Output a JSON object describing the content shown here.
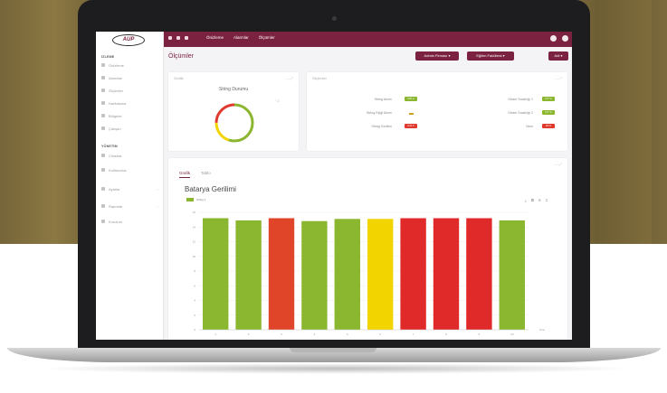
{
  "topbar": {
    "menu": [
      "Önizleme",
      "Alarmlar",
      "Ölçümler"
    ]
  },
  "sidebar": {
    "section1": "İZLEME",
    "items1": [
      "Önizleme",
      "Alarmlar",
      "Ölçümler",
      "Haritalama",
      "Bölgeler",
      "Çalışan"
    ],
    "section2": "YÖNETİM",
    "items2": [
      {
        "label": "Cihazlar",
        "chevron": false
      },
      {
        "label": "Kullanıcılar",
        "chevron": false
      },
      {
        "label": "Ayarlar",
        "chevron": true
      },
      {
        "label": "Raporlar",
        "chevron": true
      },
      {
        "label": "Kurulum",
        "chevron": false
      }
    ]
  },
  "header": {
    "title": "Ölçümler",
    "dropdown1": "Admin Firması ▾",
    "dropdown2": "Eğitim Fakültesi ▾",
    "dropdown3": "Adi ▾"
  },
  "grafik_card": {
    "title": "Grafik",
    "ctrl": "— ⤢",
    "donut_title": "String Durumu",
    "donut": {
      "green": 0.55,
      "yellow": 0.2,
      "red": 0.25
    }
  },
  "olcumler_card": {
    "title": "Ölçümler",
    "ctrl": "— ⤢",
    "rows_left": [
      {
        "label": "String Akımı",
        "value": "0.81 A",
        "color": "#8bb630"
      },
      {
        "label": "String Eşiği Akımı",
        "value": "—",
        "color": "#c9a320"
      },
      {
        "label": "String Gerilimi",
        "value": "0.01 V",
        "color": "#e03a2f"
      }
    ],
    "rows_right": [
      {
        "label": "Ortam Sıcaklığı 1",
        "value": "0.0 °C",
        "color": "#8bb630"
      },
      {
        "label": "Ortam Sıcaklığı 2",
        "value": "0.0 °C",
        "color": "#8bb630"
      },
      {
        "label": "Nem",
        "value": "20 %",
        "color": "#e03a2f"
      }
    ]
  },
  "chart_card": {
    "tab_active": "Grafik",
    "tab_other": "Tablo",
    "ctrl": "— ⤢",
    "tools": "⤓ ▦ ⊞ ⊡"
  },
  "chart_data": {
    "type": "bar",
    "title": "Batarya Gerilimi",
    "legend": [
      "String 1"
    ],
    "categories": [
      "1",
      "2",
      "3",
      "4",
      "5",
      "6",
      "7",
      "8",
      "9",
      "10"
    ],
    "values": [
      15.2,
      14.9,
      15.2,
      14.8,
      15.1,
      15.1,
      15.2,
      15.2,
      15.2,
      14.9
    ],
    "colors": [
      "#8bb630",
      "#8bb630",
      "#e0452a",
      "#8bb630",
      "#8bb630",
      "#f2d400",
      "#e02a2a",
      "#e02a2a",
      "#e02a2a",
      "#8bb630"
    ],
    "yticks": [
      "0",
      "2",
      "4",
      "6",
      "8",
      "10",
      "12",
      "14",
      "16"
    ],
    "ylim": [
      0,
      16
    ],
    "x_unit": "Sıra",
    "grid": true
  }
}
